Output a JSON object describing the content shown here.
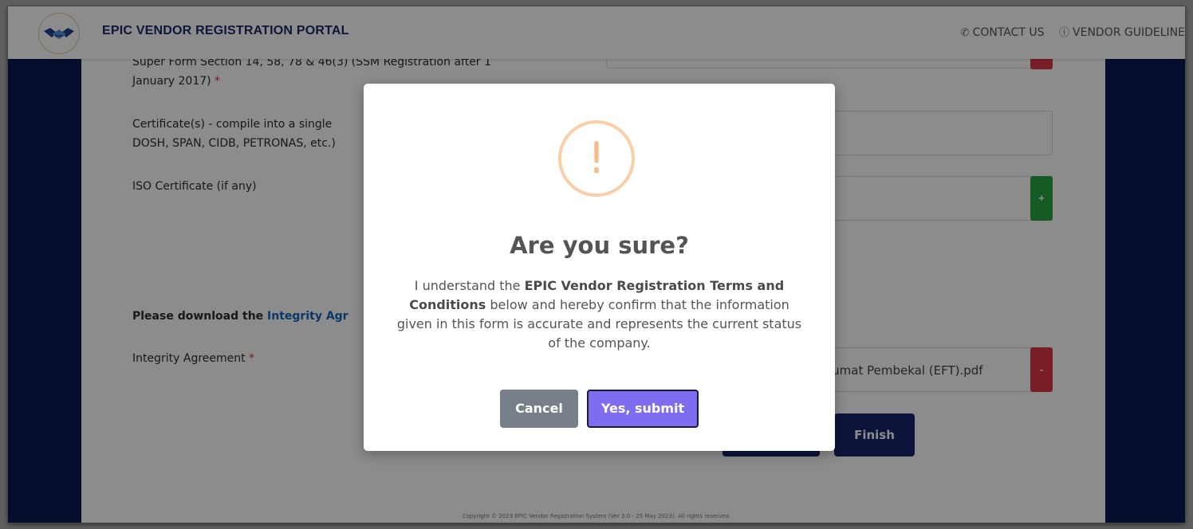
{
  "navbar": {
    "title": "EPIC VENDOR REGISTRATION PORTAL",
    "links": [
      {
        "icon": "phone-icon",
        "label": "CONTACT US"
      },
      {
        "icon": "help-circle-icon",
        "label": "VENDOR GUIDELINE"
      }
    ]
  },
  "form": {
    "super_form_label_line1": "Super Form Section 14, 58, 78 & 46(3) (SSM Registration after 1",
    "super_form_label_line2": "January 2017)",
    "certificates_label_line1": "Certificate(s) - compile into a single",
    "certificates_label_line2": "DOSH, SPAN, CIDB, PETRONAS, etc.)",
    "iso_label": "ISO Certificate (if any)",
    "download_prefix": "Please download the",
    "download_link": "Integrity Agr",
    "integrity_label": "Integrity Agreement",
    "required_mark": "*",
    "uploaded_file": "lumat Pembekal (EFT).pdf",
    "remove_label": "-",
    "add_label": "+",
    "finish_label": "Finish"
  },
  "footer": {
    "text": "Copyright © 2023 EPIC Vendor Registration System (Ver 3.0 - 25 May 2023). All rights reserved."
  },
  "modal": {
    "title": "Are you sure?",
    "icon_glyph": "!",
    "text_start": "I understand the ",
    "text_bold": "EPIC Vendor Registration Terms and Conditions",
    "text_end": " below and hereby confirm that the information given in this form is accurate and represents the current status of the company.",
    "cancel_label": "Cancel",
    "confirm_label": "Yes, submit"
  },
  "colors": {
    "sidebar": "#0c1a52",
    "brand_title": "#1a2a6b",
    "confirm_button": "#7e6df1",
    "cancel_button": "#778089",
    "warning_icon": "#f8bb86",
    "danger_button": "#dc3545",
    "success_button": "#28a745"
  }
}
